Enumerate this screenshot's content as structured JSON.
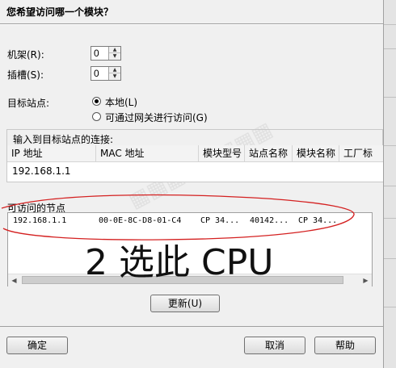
{
  "dialog": {
    "question": "您希望访问哪一个模块？",
    "rack_label": "机架(R):",
    "rack_value": "0",
    "slot_label": "插槽(S):",
    "slot_value": "0",
    "target_label": "目标站点:",
    "option_local": "本地(L)",
    "option_gateway": "可通过网关进行访问(G)",
    "connection_group_title": "输入到目标站点的连接:",
    "connection_columns": [
      "IP 地址",
      "MAC 地址",
      "模块型号",
      "站点名称",
      "模块名称",
      "工厂标"
    ],
    "connection_value": "192.168.1.1",
    "nodes_group_title": "可访问的节点",
    "node_row": [
      "192.168.1.1",
      "00-0E-8C-D8-01-C4",
      "CP 34...",
      "40142...",
      "CP 34..."
    ],
    "handwriting": "2 选此 CPU",
    "refresh_button": "更新(U)",
    "ok_button": "确定",
    "cancel_button": "取消",
    "help_button": "帮助"
  },
  "colors": {
    "annotation": "#d42020",
    "ink": "#111111"
  }
}
